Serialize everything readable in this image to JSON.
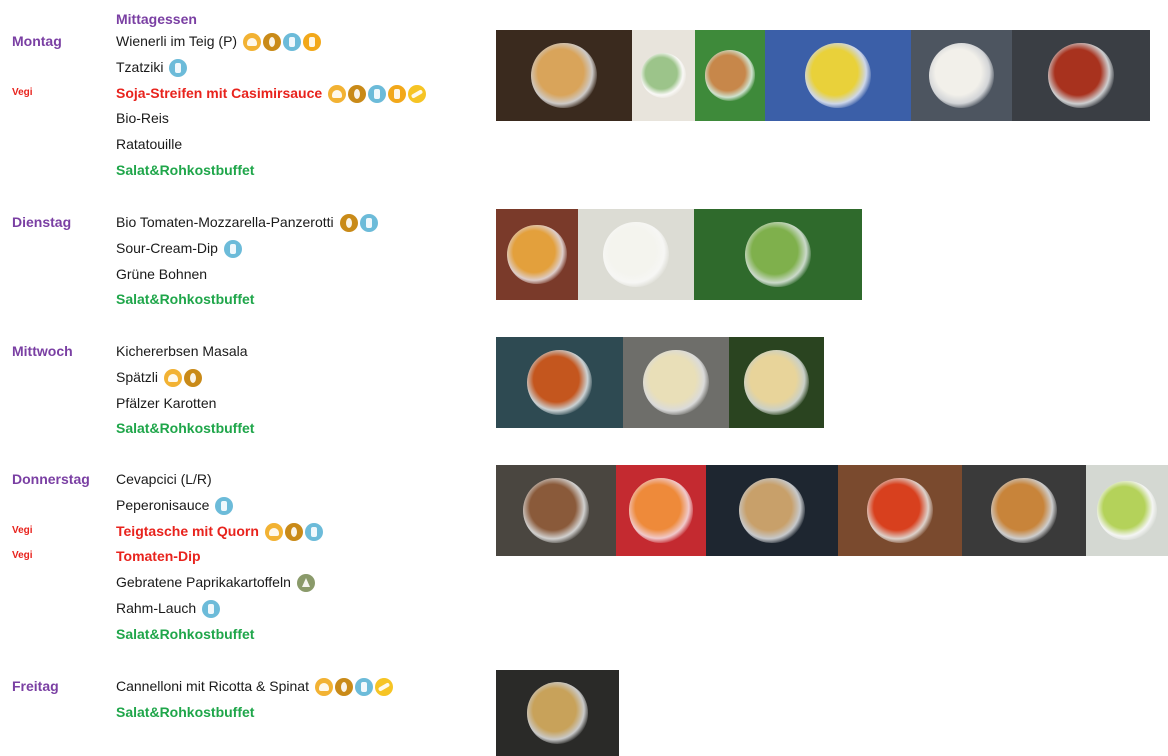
{
  "header": "Mittagessen",
  "vegi_label": "Vegi",
  "days": [
    {
      "name": "Montag",
      "items": [
        {
          "text": "Wienerli im Teig (P)",
          "style": "normal",
          "vegi": false,
          "icons": [
            "gluten",
            "egg",
            "milk",
            "celery"
          ]
        },
        {
          "text": "Tzatziki",
          "style": "normal",
          "vegi": false,
          "icons": [
            "milk"
          ]
        },
        {
          "text": "Soja-Streifen mit Casimirsauce",
          "style": "red",
          "vegi": true,
          "icons": [
            "gluten",
            "egg",
            "milk",
            "celery",
            "mustard"
          ]
        },
        {
          "text": "Bio-Reis",
          "style": "normal",
          "vegi": false,
          "icons": []
        },
        {
          "text": "Ratatouille",
          "style": "normal",
          "vegi": false,
          "icons": []
        },
        {
          "text": "Salat&Rohkostbuffet",
          "style": "green",
          "vegi": false,
          "icons": []
        }
      ],
      "photos": [
        {
          "name": "wienerli-im-teig-photo",
          "bg": "#3a2a1e",
          "accent": "#d9a45a"
        },
        {
          "name": "tzatziki-photo",
          "bg": "#e8e4dc",
          "accent": "#9cc48a"
        },
        {
          "name": "soja-streifen-photo",
          "bg": "#3e8a3a",
          "accent": "#c7874a"
        },
        {
          "name": "casimirsauce-photo",
          "bg": "#3b5fa8",
          "accent": "#e9d13a"
        },
        {
          "name": "bio-reis-photo",
          "bg": "#4d5560",
          "accent": "#f2f0ea"
        },
        {
          "name": "ratatouille-photo",
          "bg": "#3a3e44",
          "accent": "#a8321e"
        }
      ]
    },
    {
      "name": "Dienstag",
      "items": [
        {
          "text": "Bio Tomaten-Mozzarella-Panzerotti",
          "style": "normal",
          "vegi": false,
          "icons": [
            "egg",
            "milk"
          ]
        },
        {
          "text": "Sour-Cream-Dip",
          "style": "normal",
          "vegi": false,
          "icons": [
            "milk"
          ]
        },
        {
          "text": "Grüne Bohnen",
          "style": "normal",
          "vegi": false,
          "icons": []
        },
        {
          "text": "Salat&Rohkostbuffet",
          "style": "green",
          "vegi": false,
          "icons": []
        }
      ],
      "photos": [
        {
          "name": "panzerotti-photo",
          "bg": "#7a3a2a",
          "accent": "#e3a03c"
        },
        {
          "name": "sour-cream-dip-photo",
          "bg": "#dcdcd4",
          "accent": "#f4f4ee"
        },
        {
          "name": "gruene-bohnen-photo",
          "bg": "#2f6a2c",
          "accent": "#7fb04c"
        }
      ]
    },
    {
      "name": "Mittwoch",
      "items": [
        {
          "text": "Kichererbsen Masala",
          "style": "normal",
          "vegi": false,
          "icons": []
        },
        {
          "text": "Spätzli",
          "style": "normal",
          "vegi": false,
          "icons": [
            "gluten",
            "egg"
          ]
        },
        {
          "text": "Pfälzer Karotten",
          "style": "normal",
          "vegi": false,
          "icons": []
        },
        {
          "text": "Salat&Rohkostbuffet",
          "style": "green",
          "vegi": false,
          "icons": []
        }
      ],
      "photos": [
        {
          "name": "kichererbsen-masala-photo",
          "bg": "#2e4a52",
          "accent": "#c4561e"
        },
        {
          "name": "spaetzli-photo",
          "bg": "#6e6e6a",
          "accent": "#e9dfb8"
        },
        {
          "name": "pfaelzer-karotten-photo",
          "bg": "#2a4420",
          "accent": "#e8d49a"
        }
      ]
    },
    {
      "name": "Donnerstag",
      "items": [
        {
          "text": "Cevapcici (L/R)",
          "style": "normal",
          "vegi": false,
          "icons": []
        },
        {
          "text": "Peperonisauce",
          "style": "normal",
          "vegi": false,
          "icons": [
            "milk"
          ]
        },
        {
          "text": "Teigtasche mit Quorn",
          "style": "red",
          "vegi": true,
          "icons": [
            "gluten",
            "egg",
            "milk"
          ]
        },
        {
          "text": "Tomaten-Dip",
          "style": "red",
          "vegi": true,
          "icons": []
        },
        {
          "text": "Gebratene Paprikakartoffeln",
          "style": "normal",
          "vegi": false,
          "icons": [
            "sulfite"
          ]
        },
        {
          "text": "Rahm-Lauch",
          "style": "normal",
          "vegi": false,
          "icons": [
            "milk"
          ]
        },
        {
          "text": "Salat&Rohkostbuffet",
          "style": "green",
          "vegi": false,
          "icons": []
        }
      ],
      "photos": [
        {
          "name": "cevapcici-photo",
          "bg": "#4a4640",
          "accent": "#8a5a3a"
        },
        {
          "name": "peperonisauce-photo",
          "bg": "#c42a30",
          "accent": "#ee8a3a"
        },
        {
          "name": "teigtasche-photo",
          "bg": "#1e2630",
          "accent": "#c8a06a"
        },
        {
          "name": "tomaten-dip-photo",
          "bg": "#7a4a2e",
          "accent": "#d8401e"
        },
        {
          "name": "paprikakartoffeln-photo",
          "bg": "#3a3a3a",
          "accent": "#c8843a"
        },
        {
          "name": "rahm-lauch-photo",
          "bg": "#d4d8d2",
          "accent": "#b4d25a"
        }
      ]
    },
    {
      "name": "Freitag",
      "items": [
        {
          "text": "Cannelloni mit Ricotta & Spinat",
          "style": "normal",
          "vegi": false,
          "icons": [
            "gluten",
            "egg",
            "milk",
            "mustard"
          ]
        },
        {
          "text": "Salat&Rohkostbuffet",
          "style": "green",
          "vegi": false,
          "icons": []
        }
      ],
      "photos": [
        {
          "name": "cannelloni-photo",
          "bg": "#2a2a28",
          "accent": "#c8a25a"
        }
      ]
    }
  ]
}
